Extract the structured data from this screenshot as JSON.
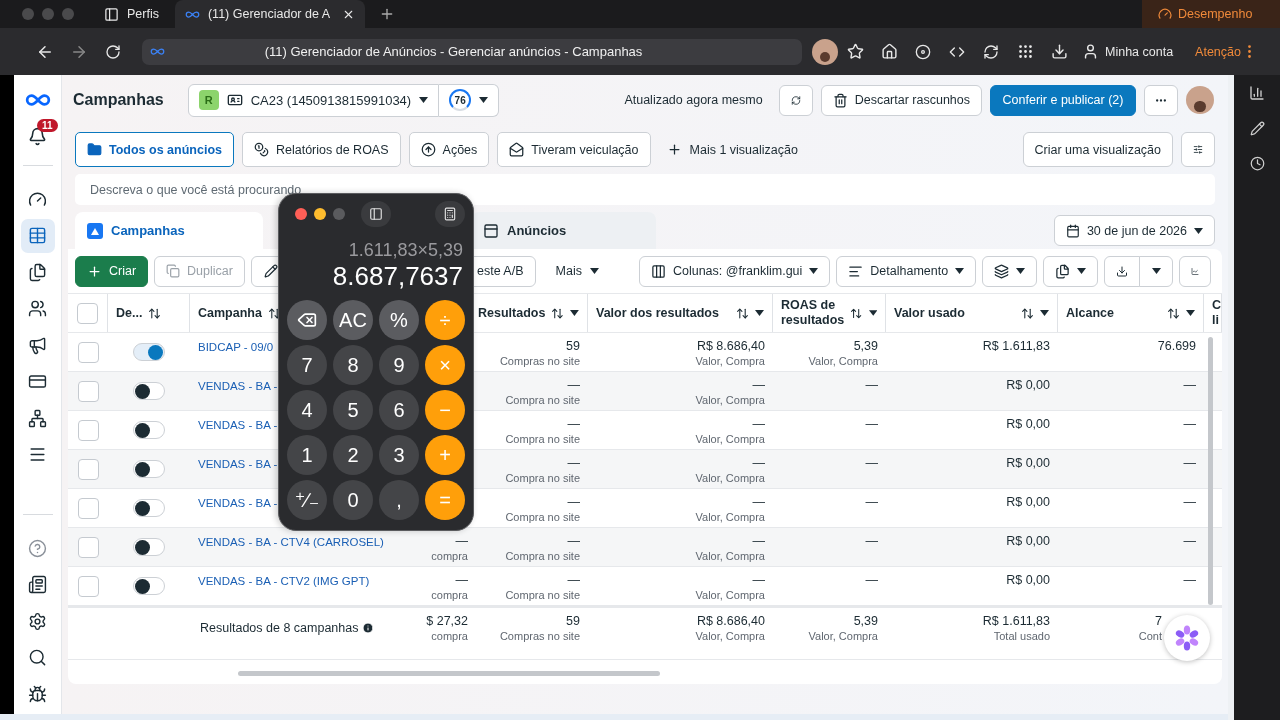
{
  "browser": {
    "tabs": [
      {
        "label": "Perfis",
        "kind": "profiles",
        "selected": false
      },
      {
        "label": "(11) Gerenciador de A",
        "kind": "page",
        "selected": true
      }
    ],
    "performance": "Desempenho",
    "address": "(11) Gerenciador de Anúncios - Gerenciar anúncios - Campanhas",
    "account": "Minha conta",
    "alert": "Atenção"
  },
  "nav": {
    "badge": "11",
    "items": [
      {
        "kind": "dashboard",
        "selected": false
      },
      {
        "kind": "table",
        "selected": true
      },
      {
        "kind": "documents",
        "selected": false
      },
      {
        "kind": "people",
        "selected": false
      },
      {
        "kind": "megaphone",
        "selected": false
      },
      {
        "kind": "card",
        "selected": false
      },
      {
        "kind": "network",
        "selected": false
      },
      {
        "kind": "menu",
        "selected": false
      }
    ],
    "bottom_items": [
      {
        "kind": "help"
      },
      {
        "kind": "news"
      },
      {
        "kind": "settings"
      },
      {
        "kind": "search"
      },
      {
        "kind": "bug"
      }
    ]
  },
  "header": {
    "title": "Campanhas",
    "account_badge": "R",
    "account": "CA23 (1450913815991034)",
    "score": "76",
    "updated": "Atualizado agora mesmo",
    "discard": "Descartar rascunhos",
    "publish": "Conferir e publicar (2)"
  },
  "views": [
    {
      "label": "Todos os anúncios",
      "kind": "folder",
      "selected": true
    },
    {
      "label": "Relatórios de ROAS",
      "kind": "report",
      "selected": false
    },
    {
      "label": "Ações",
      "kind": "actions",
      "selected": false
    },
    {
      "label": "Tiveram veiculação",
      "kind": "mail",
      "selected": false
    }
  ],
  "add_view": "Mais 1 visualização",
  "create_view": "Criar uma visualização",
  "search": {
    "placeholder": "Descreva o que você está procurando"
  },
  "levels": [
    {
      "label": "Campanhas",
      "kind": "campaign",
      "selected": true
    },
    {
      "label": "Anúncios",
      "kind": "ad",
      "selected": false
    }
  ],
  "date": "30 de jun de 2026",
  "toolbar": {
    "create": "Criar",
    "duplicate": {
      "label": "Duplicar",
      "disabled": true
    },
    "ab_test": "este A/B",
    "more": "Mais",
    "columns": "Colunas: @franklim.gui",
    "breakdown": "Detalhamento"
  },
  "table": {
    "select_all": {
      "checked": false
    },
    "columns": [
      {
        "label": "De...",
        "sort": true,
        "menu": false
      },
      {
        "label": "Campanha",
        "sort": true,
        "menu": false
      },
      {
        "label": "Resultados",
        "sort": true,
        "menu": true
      },
      {
        "label": "Valor dos resultados",
        "sort": true,
        "menu": true
      },
      {
        "label": "ROAS de resultados",
        "sort": true,
        "menu": true
      },
      {
        "label": "Valor usado",
        "sort": true,
        "menu": true
      },
      {
        "label": "Alcance",
        "sort": true,
        "menu": true
      },
      {
        "label": "C li",
        "sort": false,
        "menu": false
      }
    ],
    "rows": [
      {
        "checked": false,
        "active": true,
        "campaign": "BIDCAP - 09/0",
        "results": "59",
        "results_sub": "Compras no site",
        "value": "R$ 8.686,40",
        "value_sub": "Valor, Compra",
        "roas": "5,39",
        "roas_sub": "Valor, Compra",
        "spent": "R$ 1.611,83",
        "reach": "76.699"
      },
      {
        "checked": false,
        "active": false,
        "campaign": "VENDAS - BA -",
        "results": "—",
        "results_sub": "Compra no site",
        "value": "—",
        "value_sub": "Valor, Compra",
        "roas": "—",
        "spent": "R$ 0,00",
        "reach": "—"
      },
      {
        "checked": false,
        "active": false,
        "campaign": "VENDAS - BA -",
        "results": "—",
        "results_sub": "Compra no site",
        "value": "—",
        "value_sub": "Valor, Compra",
        "roas": "—",
        "spent": "R$ 0,00",
        "reach": "—"
      },
      {
        "checked": false,
        "active": false,
        "campaign": "VENDAS - BA -",
        "results": "—",
        "results_sub": "Compra no site",
        "value": "—",
        "value_sub": "Valor, Compra",
        "roas": "—",
        "spent": "R$ 0,00",
        "reach": "—"
      },
      {
        "checked": false,
        "active": false,
        "campaign": "VENDAS - BA -",
        "results": "—",
        "results_sub": "Compra no site",
        "value": "—",
        "value_sub": "Valor, Compra",
        "roas": "—",
        "spent": "R$ 0,00",
        "reach": "—"
      },
      {
        "checked": false,
        "active": false,
        "campaign": "VENDAS - BA - CTV4 (CARROSEL)",
        "column_4": "—",
        "column_4_sub": "compra",
        "results": "—",
        "results_sub": "Compra no site",
        "value": "—",
        "value_sub": "Valor, Compra",
        "roas": "—",
        "spent": "R$ 0,00",
        "reach": "—"
      },
      {
        "checked": false,
        "active": false,
        "campaign": "VENDAS - BA - CTV2 (IMG GPT)",
        "column_4": "—",
        "column_4_sub": "compra",
        "results": "—",
        "results_sub": "Compra no site",
        "value": "—",
        "value_sub": "Valor, Compra",
        "roas": "—",
        "spent": "R$ 0,00",
        "reach": "—"
      }
    ],
    "footer": {
      "label": "Resultados de 8 campanhas",
      "column_4": "$ 27,32",
      "column_4_sub": "compra",
      "results": "59",
      "results_sub": "Compras no site",
      "value": "R$ 8.686,40",
      "value_sub": "Valor, Compra",
      "roas": "5,39",
      "roas_sub": "Valor, Compra",
      "spent": "R$ 1.611,83",
      "spent_sub": "Total usado",
      "reach": "7",
      "reach_sub": "Cont"
    }
  },
  "calculator": {
    "expression": "1.611,83×5,39",
    "result": "8.687,7637",
    "keys": [
      {
        "kind": "backspace"
      },
      {
        "label": "AC",
        "kind": "fn"
      },
      {
        "label": "%",
        "kind": "fn"
      },
      {
        "label": "÷",
        "kind": "op"
      },
      {
        "label": "7",
        "kind": "digit"
      },
      {
        "label": "8",
        "kind": "digit"
      },
      {
        "label": "9",
        "kind": "digit"
      },
      {
        "label": "×",
        "kind": "op"
      },
      {
        "label": "4",
        "kind": "digit"
      },
      {
        "label": "5",
        "kind": "digit"
      },
      {
        "label": "6",
        "kind": "digit"
      },
      {
        "label": "−",
        "kind": "op"
      },
      {
        "label": "1",
        "kind": "digit"
      },
      {
        "label": "2",
        "kind": "digit"
      },
      {
        "label": "3",
        "kind": "digit"
      },
      {
        "label": "+",
        "kind": "op"
      },
      {
        "label": "⁺∕₋",
        "kind": "digit"
      },
      {
        "label": "0",
        "kind": "digit"
      },
      {
        "label": ",",
        "kind": "digit"
      },
      {
        "label": "=",
        "kind": "op"
      }
    ]
  }
}
